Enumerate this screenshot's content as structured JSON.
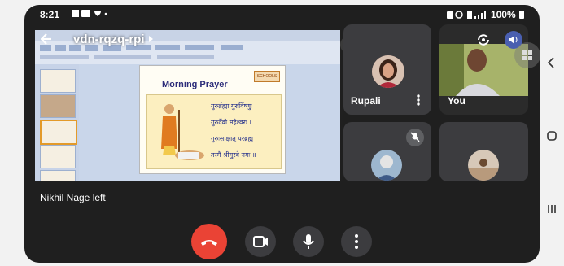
{
  "status_bar": {
    "time": "8:21",
    "battery": "100%"
  },
  "meeting": {
    "code": "vdn-rqzq-rpi"
  },
  "presentation": {
    "slide_title": "Morning Prayer",
    "logo_text": "SCHOOLS",
    "verses": [
      "गुरुर्ब्रह्मा गुरुर्विष्णुः",
      "गुरुर्देवो महेश्वरः ।",
      "गुरुःसाक्षात् परब्रह्म",
      "तस्मै श्रीगुरवे नमः ॥"
    ]
  },
  "participants": [
    {
      "name": "Rupali",
      "muted": false
    },
    {
      "name": "You",
      "muted": false
    },
    {
      "name": "",
      "muted": true
    },
    {
      "name": "",
      "muted": false
    }
  ],
  "notification": "Nikhil Nage left",
  "controls": [
    "end-call",
    "camera",
    "microphone",
    "more"
  ],
  "colors": {
    "end_call": "#ea4335",
    "tile_bg": "#3c3c3f",
    "screen_bg": "#1f1f1f"
  },
  "icons": [
    "back-arrow-icon",
    "chevron-right-icon",
    "mic-off-icon",
    "switch-camera-icon",
    "volume-icon",
    "more-vert-icon",
    "grid-icon",
    "phone-hangup-icon",
    "camera-icon",
    "mic-icon"
  ]
}
